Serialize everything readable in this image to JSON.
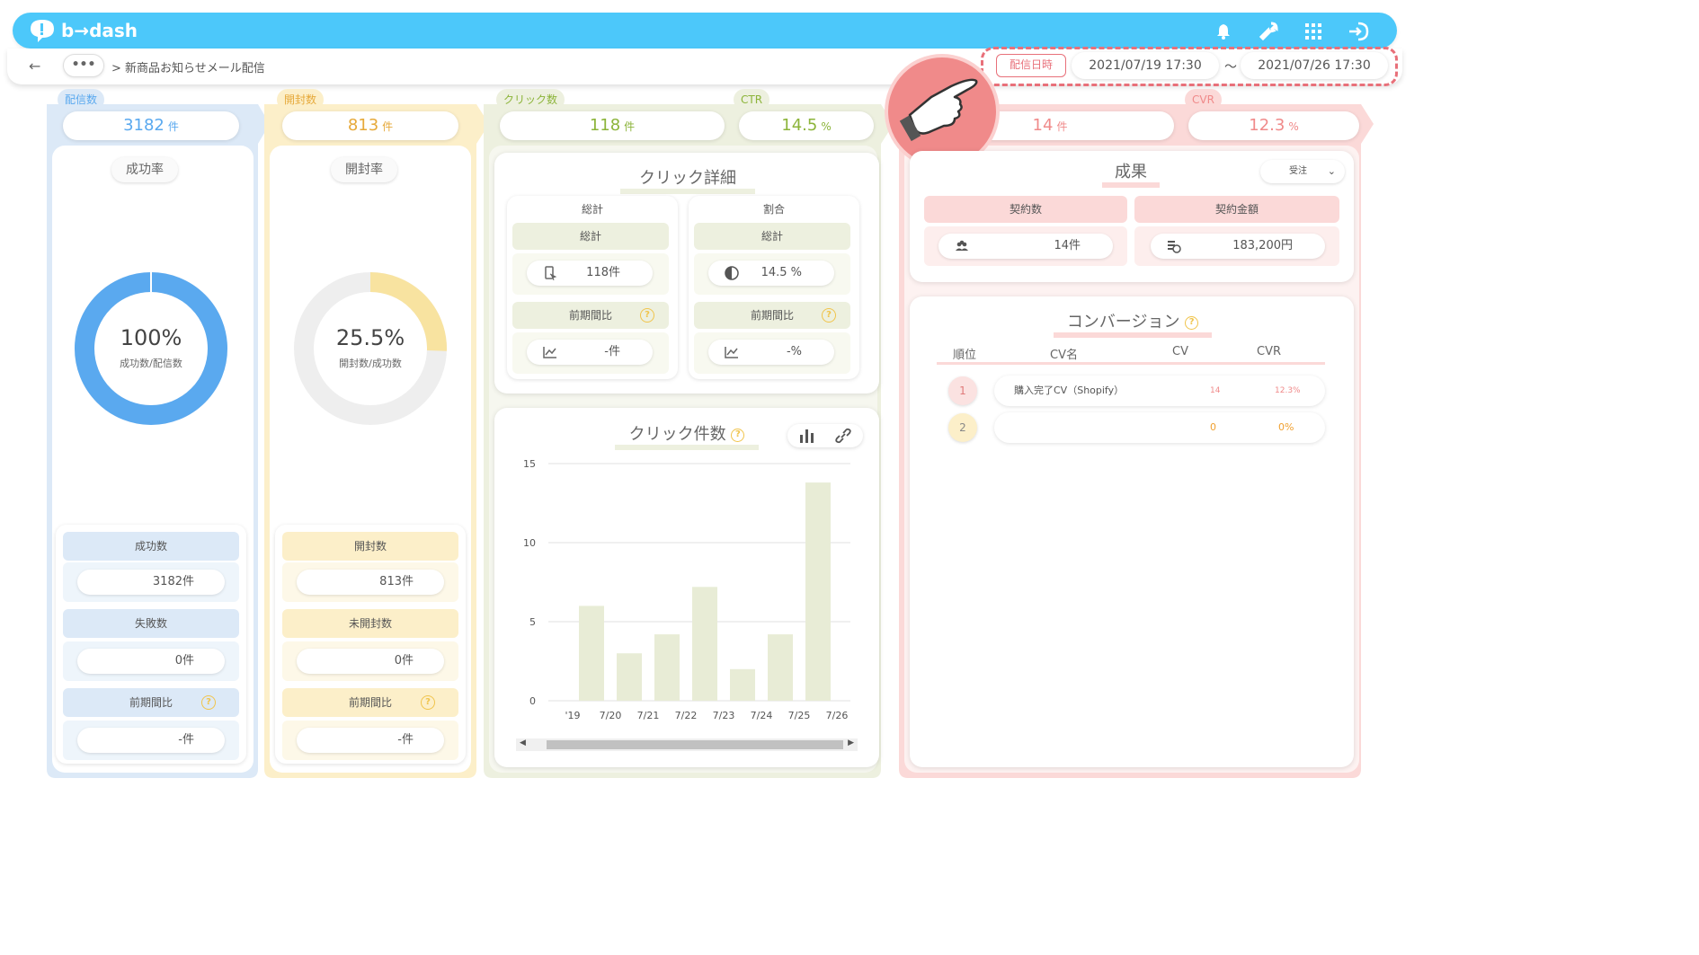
{
  "app": {
    "logo_text": "b→dash"
  },
  "topbar": {
    "icons": [
      "bell-icon",
      "wrench-icon",
      "grid-icon",
      "logout-icon"
    ]
  },
  "breadcrumb": {
    "back": "←",
    "more": "•••",
    "path": "> 新商品お知らせメール配信"
  },
  "date_range": {
    "label": "配信日時",
    "start": "2021/07/19 17:30",
    "separator": "〜",
    "end": "2021/07/26 17:30"
  },
  "delivery": {
    "tag": "配信数",
    "kpi_value": "3182",
    "kpi_unit": "件",
    "rate_title": "成功率",
    "rate_value": "100%",
    "rate_caption": "成功数/配信数",
    "rate_fraction": 1.0,
    "stats": [
      {
        "label": "成功数",
        "value": "3182件"
      },
      {
        "label": "失敗数",
        "value": "0件"
      },
      {
        "label": "前期間比",
        "value": "-件"
      }
    ]
  },
  "opens": {
    "tag": "開封数",
    "kpi_value": "813",
    "kpi_unit": "件",
    "rate_title": "開封率",
    "rate_value": "25.5%",
    "rate_caption": "開封数/成功数",
    "rate_fraction": 0.255,
    "stats": [
      {
        "label": "開封数",
        "value": "813件"
      },
      {
        "label": "未開封数",
        "value": "0件"
      },
      {
        "label": "前期間比",
        "value": "-件"
      }
    ]
  },
  "clicks": {
    "tag": "クリック数",
    "kpi_value": "118",
    "kpi_unit": "件",
    "ctr_tag": "CTR",
    "ctr_value": "14.5",
    "ctr_unit": "%",
    "detail_title": "クリック詳細",
    "total": {
      "header": "総計",
      "sub": "総計",
      "value": "118件",
      "compare": "前期間比",
      "compare_value": "-件"
    },
    "ratio": {
      "header": "割合",
      "sub": "総計",
      "value": "14.5 %",
      "compare": "前期間比",
      "compare_value": "-%"
    },
    "chart_title": "クリック件数"
  },
  "results": {
    "kpi_value": "14",
    "kpi_unit": "件",
    "cvr_tag": "CVR",
    "cvr_value": "12.3",
    "cvr_unit": "%",
    "title": "成果",
    "select_value": "受注",
    "contracts_label": "契約数",
    "contracts_value": "14件",
    "amount_label": "契約金額",
    "amount_value": "183,200円"
  },
  "conversion": {
    "title": "コンバージョン",
    "headers": [
      "順位",
      "CV名",
      "CV",
      "CVR"
    ],
    "rows": [
      {
        "rank": "1",
        "name": "購入完了CV（Shopify）",
        "cv": "14",
        "cvr": "12.3%"
      },
      {
        "rank": "2",
        "name": "",
        "cv": "0",
        "cvr": "0%"
      }
    ]
  },
  "chart_data": {
    "type": "bar",
    "title": "クリック件数",
    "categories": [
      "'19",
      "7/20",
      "7/21",
      "7/22",
      "7/23",
      "7/24",
      "7/25",
      "7/26"
    ],
    "values": [
      6,
      3,
      4.2,
      7.2,
      2,
      4.2,
      13.8
    ],
    "ylim": [
      0,
      15
    ],
    "yticks": [
      0,
      5,
      10,
      15
    ],
    "colors": {
      "bar": "#e8ecd6"
    }
  },
  "colors": {
    "blue": "#5aa9ef",
    "yellow": "#f8e3a0",
    "green": "#8cb43a",
    "pink": "#f08a8a",
    "topbar": "#4cc8fa"
  }
}
